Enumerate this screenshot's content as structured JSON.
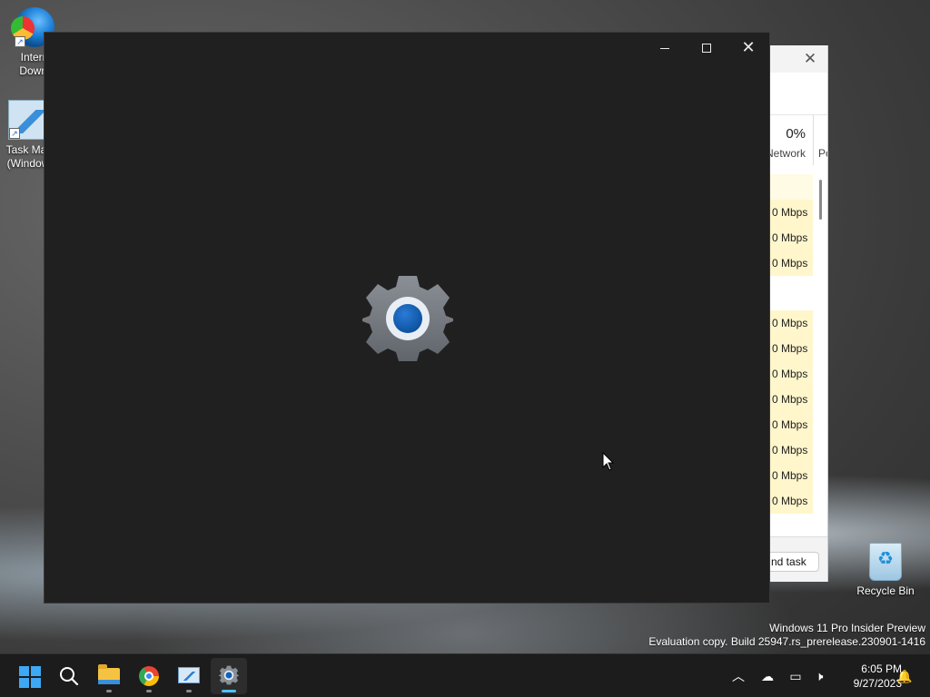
{
  "desktop": {
    "icons": [
      {
        "label_line1": "Intern",
        "label_line2": "Downl"
      },
      {
        "label_line1": "Task Mar",
        "label_line2": "(Window"
      }
    ],
    "recycle_bin_label": "Recycle Bin"
  },
  "task_manager_bg": {
    "network_percent": "0%",
    "network_header": "Network",
    "next_col_header": "Po",
    "rows": [
      "",
      "0 Mbps",
      "0 Mbps",
      "0 Mbps",
      "",
      "0 Mbps",
      "0 Mbps",
      "0 Mbps",
      "0 Mbps",
      "0 Mbps",
      "0 Mbps",
      "0 Mbps",
      "0 Mbps"
    ],
    "end_task_label": "nd task"
  },
  "settings_splash": {
    "icon": "settings-gear-icon",
    "accent_color": "#0f5fb0"
  },
  "watermark": {
    "line1": "Windows 11 Pro Insider Preview",
    "line2": "Evaluation copy. Build 25947.rs_prerelease.230901-1416"
  },
  "taskbar": {
    "items": [
      "start",
      "search",
      "file-explorer",
      "chrome",
      "task-manager",
      "settings"
    ],
    "active": "settings",
    "clock_time": "6:05 PM",
    "clock_date": "9/27/2023"
  }
}
